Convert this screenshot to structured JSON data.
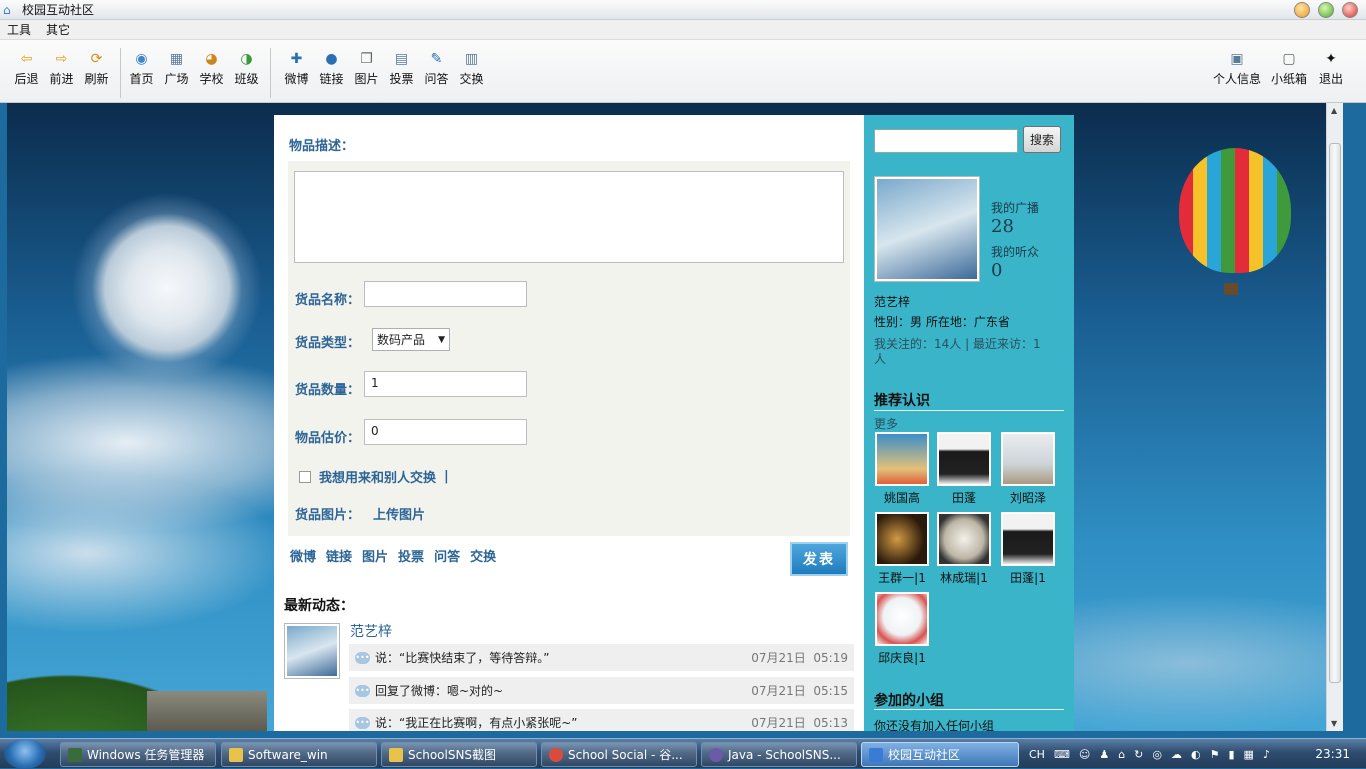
{
  "window": {
    "title": "校园互动社区"
  },
  "menu": [
    "工具",
    "其它"
  ],
  "toolbar": {
    "nav": [
      {
        "label": "后退",
        "icon": "back-arrow-icon"
      },
      {
        "label": "前进",
        "icon": "forward-arrow-icon"
      },
      {
        "label": "刷新",
        "icon": "refresh-icon"
      }
    ],
    "sections": [
      {
        "label": "首页",
        "icon": "globe-icon"
      },
      {
        "label": "广场",
        "icon": "grid-icon"
      },
      {
        "label": "学校",
        "icon": "school-icon"
      },
      {
        "label": "班级",
        "icon": "class-icon"
      }
    ],
    "post_types": [
      {
        "label": "微博",
        "icon": "plus-icon"
      },
      {
        "label": "链接",
        "icon": "link-icon"
      },
      {
        "label": "图片",
        "icon": "picture-icon"
      },
      {
        "label": "投票",
        "icon": "vote-icon"
      },
      {
        "label": "问答",
        "icon": "qa-icon"
      },
      {
        "label": "交换",
        "icon": "exchange-icon"
      }
    ],
    "user": [
      {
        "label": "个人信息",
        "icon": "profile-icon"
      },
      {
        "label": "小纸箱",
        "icon": "mailbox-icon"
      },
      {
        "label": "退出",
        "icon": "exit-runner-icon"
      }
    ]
  },
  "form": {
    "desc_label": "物品描述：",
    "name_label": "货品名称：",
    "name_value": "",
    "type_label": "货品类型：",
    "type_value": "数码产品",
    "qty_label": "货品数量：",
    "qty_value": "1",
    "price_label": "物品估价：",
    "price_value": "0",
    "exchange_label": "我想用来和别人交换",
    "exchange_sep": "|",
    "image_label": "货品图片：",
    "upload_label": "上传图片",
    "tabs": [
      "微博",
      "链接",
      "图片",
      "投票",
      "问答",
      "交换"
    ],
    "submit_label": "发表"
  },
  "feed": {
    "heading": "最新动态：",
    "user": "范艺梓",
    "items": [
      {
        "text": "说：“比赛快结束了，等待答辩。”",
        "date": "07月21日",
        "time": "05:19"
      },
      {
        "text": "回复了微博：嗯~对的~",
        "date": "07月21日",
        "time": "05:15"
      },
      {
        "text": "说：“我正在比赛啊，有点小紧张呢~”",
        "date": "07月21日",
        "time": "05:13"
      }
    ]
  },
  "sidebar": {
    "search_button": "搜索",
    "broadcast_label": "我的广播",
    "broadcast_count": "28",
    "listeners_label": "我的听众",
    "listeners_count": "0",
    "name": "范艺梓",
    "info": "性别：男  所在地：广东省",
    "follow": "我关注的：14人 | 最近来访：1",
    "follow_cont": "人",
    "recommend_heading": "推荐认识",
    "more": "更多",
    "friends": [
      "姚国高",
      "田蓬",
      "刘昭泽",
      "王群一|1",
      "林成瑞|1",
      "田蓬|1",
      "邱庆良|1"
    ],
    "groups_heading": "参加的小组",
    "groups_text": "你还没有加入任何小组"
  },
  "taskbar": {
    "tasks": [
      {
        "label": "Windows 任务管理器",
        "color": "#3a6b3a"
      },
      {
        "label": "Software_win",
        "color": "#e8c24a"
      },
      {
        "label": "SchoolSNS截图",
        "color": "#e8c24a"
      },
      {
        "label": "School Social - 谷...",
        "color": "#d94b3a"
      },
      {
        "label": "Java - SchoolSNS...",
        "color": "#6b5aa8"
      },
      {
        "label": "校园互动社区",
        "color": "#3a7bd5"
      }
    ],
    "lang": "CH",
    "clock": "23:31"
  }
}
